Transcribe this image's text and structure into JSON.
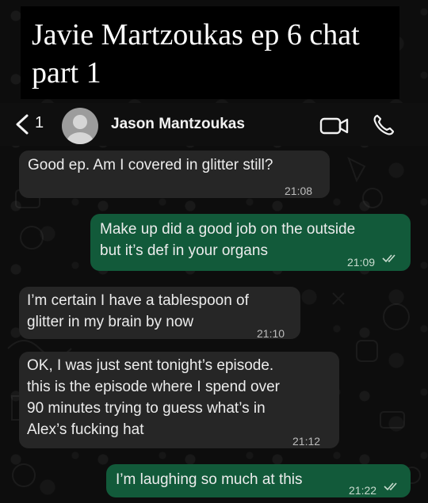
{
  "caption": {
    "line1": "Javie Martzoukas ep 6 chat",
    "line2": "part 1"
  },
  "header": {
    "back_count": "1",
    "contact_name": "Jason Mantzoukas"
  },
  "messages": [
    {
      "dir": "in",
      "text": "Good ep.  Am I covered in glitter still?",
      "time": "21:08"
    },
    {
      "dir": "out",
      "text": "Make up did a good job on the outside\nbut it’s def in your organs",
      "time": "21:09",
      "read": true
    },
    {
      "dir": "in",
      "text": "I’m certain I have a tablespoon of\nglitter in my brain by now",
      "time": "21:10"
    },
    {
      "dir": "in",
      "text": "OK, I was just sent tonight’s episode.\nthis is the episode where I spend over\n90 minutes trying to guess what’s in\nAlex’s fucking hat",
      "time": "21:12"
    },
    {
      "dir": "out",
      "text": "I’m laughing so much at this",
      "time": "21:22",
      "read": true
    }
  ],
  "colors": {
    "incoming": "#262626",
    "outgoing": "#125a3a",
    "background": "#0d0d0d",
    "read_tick": "#c9dccf"
  },
  "icons": [
    "back-chevron-icon",
    "avatar-silhouette-icon",
    "video-camera-icon",
    "phone-icon",
    "double-check-icon"
  ]
}
